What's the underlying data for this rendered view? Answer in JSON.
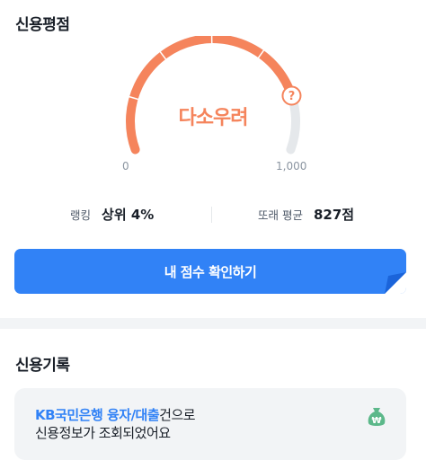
{
  "score_section": {
    "title": "신용평점",
    "status": "다소우려",
    "gauge_min": "0",
    "gauge_max": "1,000",
    "gauge_fill": 0.827,
    "help_icon": "question-circle-icon",
    "colors": {
      "accent": "#f5845c",
      "track": "#e5e8eb"
    }
  },
  "stats": {
    "rank_label": "랭킹",
    "rank_value": "상위 4%",
    "peer_label": "또래 평균",
    "peer_value": "827점"
  },
  "primary_button": {
    "label": "내 점수 확인하기",
    "color": "#3182f6"
  },
  "history_section": {
    "title": "신용기록",
    "record": {
      "highlight": "KB국민은행 융자/대출",
      "text_rest": "건으로",
      "line2": "신용정보가 조회되었어요",
      "icon": "money-bag-icon"
    }
  }
}
